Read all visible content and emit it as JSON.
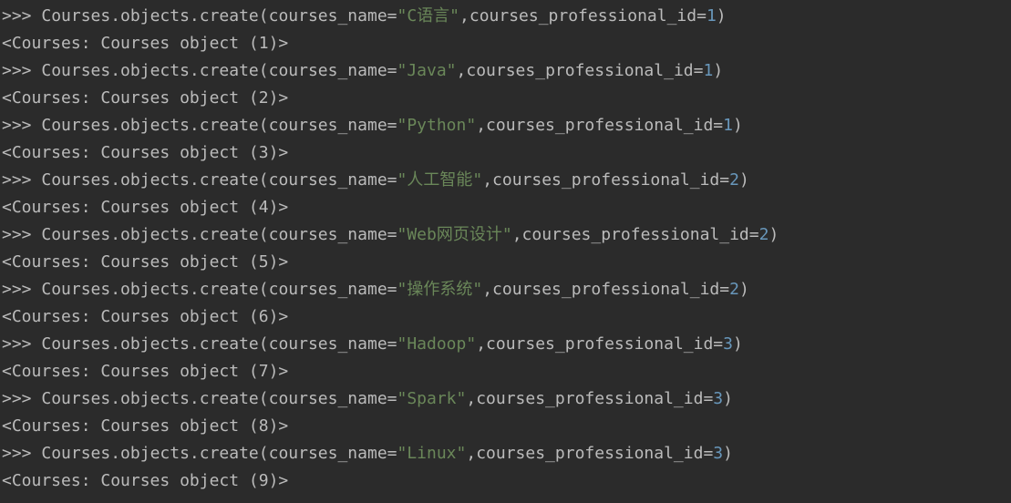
{
  "colors": {
    "background": "#2b2b2b",
    "text": "#bbbbbb",
    "string": "#6a8759",
    "number": "#6897bb"
  },
  "lines": [
    {
      "prompt": ">>> ",
      "code_prefix": "Courses.objects.create(courses_name=",
      "string": "\"C语言\"",
      "code_mid": ",courses_professional_id=",
      "number": "1",
      "code_suffix": ")"
    },
    {
      "output": "<Courses: Courses object (1)>"
    },
    {
      "prompt": ">>> ",
      "code_prefix": "Courses.objects.create(courses_name=",
      "string": "\"Java\"",
      "code_mid": ",courses_professional_id=",
      "number": "1",
      "code_suffix": ")"
    },
    {
      "output": "<Courses: Courses object (2)>"
    },
    {
      "prompt": ">>> ",
      "code_prefix": "Courses.objects.create(courses_name=",
      "string": "\"Python\"",
      "code_mid": ",courses_professional_id=",
      "number": "1",
      "code_suffix": ")"
    },
    {
      "output": "<Courses: Courses object (3)>"
    },
    {
      "prompt": ">>> ",
      "code_prefix": "Courses.objects.create(courses_name=",
      "string": "\"人工智能\"",
      "code_mid": ",courses_professional_id=",
      "number": "2",
      "code_suffix": ")"
    },
    {
      "output": "<Courses: Courses object (4)>"
    },
    {
      "prompt": ">>> ",
      "code_prefix": "Courses.objects.create(courses_name=",
      "string": "\"Web网页设计\"",
      "code_mid": ",courses_professional_id=",
      "number": "2",
      "code_suffix": ")"
    },
    {
      "output": "<Courses: Courses object (5)>"
    },
    {
      "prompt": ">>> ",
      "code_prefix": "Courses.objects.create(courses_name=",
      "string": "\"操作系统\"",
      "code_mid": ",courses_professional_id=",
      "number": "2",
      "code_suffix": ")"
    },
    {
      "output": "<Courses: Courses object (6)>"
    },
    {
      "prompt": ">>> ",
      "code_prefix": "Courses.objects.create(courses_name=",
      "string": "\"Hadoop\"",
      "code_mid": ",courses_professional_id=",
      "number": "3",
      "code_suffix": ")"
    },
    {
      "output": "<Courses: Courses object (7)>"
    },
    {
      "prompt": ">>> ",
      "code_prefix": "Courses.objects.create(courses_name=",
      "string": "\"Spark\"",
      "code_mid": ",courses_professional_id=",
      "number": "3",
      "code_suffix": ")"
    },
    {
      "output": "<Courses: Courses object (8)>"
    },
    {
      "prompt": ">>> ",
      "code_prefix": "Courses.objects.create(courses_name=",
      "string": "\"Linux\"",
      "code_mid": ",courses_professional_id=",
      "number": "3",
      "code_suffix": ")"
    },
    {
      "output": "<Courses: Courses object (9)>"
    }
  ]
}
